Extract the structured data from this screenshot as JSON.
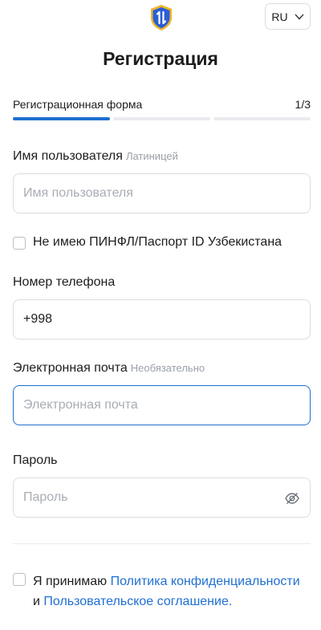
{
  "header": {
    "logo_icon": "shield-logo-icon",
    "language": {
      "selected": "RU",
      "icon": "chevron-down-icon"
    }
  },
  "page": {
    "title": "Регистрация"
  },
  "steps": {
    "label": "Регистрационная форма",
    "counter": "1/3",
    "current": 1,
    "total": 3
  },
  "form": {
    "username": {
      "label": "Имя пользователя",
      "hint": "Латиницей",
      "placeholder": "Имя пользователя",
      "value": ""
    },
    "no_pinfl": {
      "label": "Не имею ПИНФЛ/Паспорт ID Узбекистана",
      "checked": false
    },
    "phone": {
      "label": "Номер телефона",
      "value": "+998"
    },
    "email": {
      "label": "Электронная почта",
      "hint": "Необязательно",
      "placeholder": "Электронная почта",
      "value": ""
    },
    "password": {
      "label": "Пароль",
      "placeholder": "Пароль",
      "value": "",
      "toggle_icon": "eye-slash-icon"
    }
  },
  "terms": {
    "checked": false,
    "prefix": "Я принимаю ",
    "privacy_link": "Политика конфиденциальности",
    "conjunction": " и ",
    "agreement_link": "Пользовательское соглашение."
  },
  "colors": {
    "accent": "#1f6fd1",
    "border": "#d9dce1",
    "placeholder": "#a8adb4",
    "logo_blue": "#2a5fd6",
    "logo_gold": "#f0b429"
  }
}
